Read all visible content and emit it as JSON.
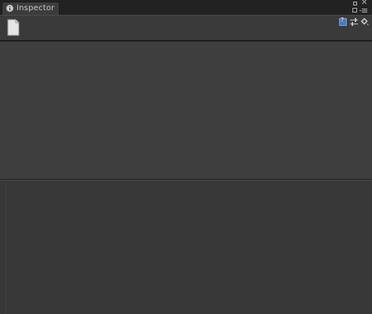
{
  "tab": {
    "label": "Inspector",
    "icon": "info-icon"
  },
  "window_controls": {
    "restore": "restore-icon",
    "close": "✕",
    "lock": "lock-icon",
    "menu": "menu-icon"
  },
  "header": {
    "asset_icon": "document-icon",
    "help_icon": "help-icon",
    "presets_icon": "presets-icon",
    "settings_icon": "gear-icon"
  },
  "colors": {
    "background": "#383838",
    "tabbar": "#222222",
    "help_accent": "#4a78b8"
  }
}
